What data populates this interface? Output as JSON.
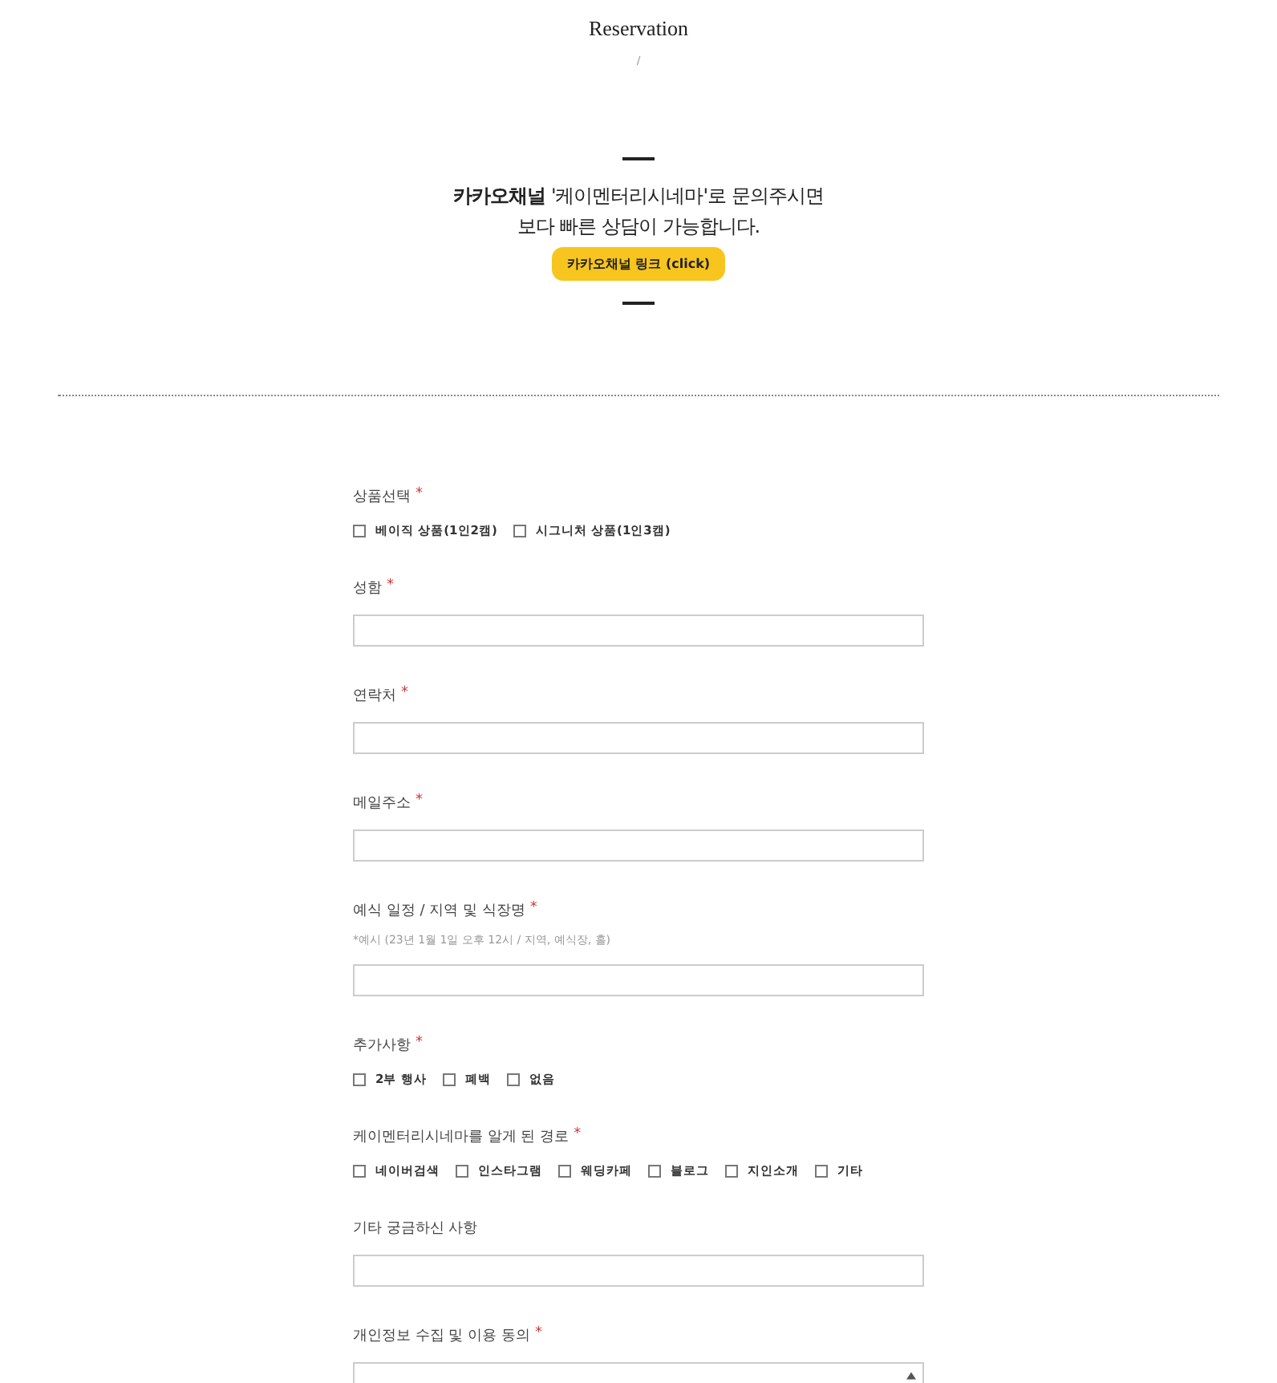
{
  "header": {
    "title": "Reservation",
    "breadcrumb": "/"
  },
  "notice": {
    "lines": [
      "**카카오채널** '케이멘터리시네마'로 문의주시면",
      "보다 빠른 상담이 가능합니다."
    ],
    "button": "카카오채널 링크 (click)"
  },
  "form": {
    "fields": [
      {
        "kind": "checkboxes",
        "label": "상품선택",
        "required_mark": "*",
        "options": [
          {
            "label": "베이직 상품(1인2캠)",
            "checked": false
          },
          {
            "label": "시그니처 상품(1인3캠)",
            "checked": false
          }
        ]
      },
      {
        "kind": "text",
        "label": "성함",
        "required_mark": "*"
      },
      {
        "kind": "text",
        "label": "연락처",
        "required_mark": "*"
      },
      {
        "kind": "text",
        "label": "메일주소",
        "required_mark": "*"
      },
      {
        "kind": "text",
        "label": "예식 일정 / 지역 및 식장명",
        "required_mark": "*",
        "hint": "*예시 (23년 1월 1일 오후 12시 / 지역, 예식장, 홀)"
      },
      {
        "kind": "checkboxes",
        "label": "추가사항",
        "required_mark": "*",
        "options": [
          {
            "label": "2부 행사",
            "checked": false
          },
          {
            "label": "폐백",
            "checked": false
          },
          {
            "label": "없음",
            "checked": false
          }
        ]
      },
      {
        "kind": "checkboxes",
        "label": "케이멘터리시네마를 알게 된 경로",
        "required_mark": "*",
        "options": [
          {
            "label": "네이버검색",
            "checked": false
          },
          {
            "label": "인스타그램",
            "checked": false
          },
          {
            "label": "웨딩카페",
            "checked": false
          },
          {
            "label": "블로그",
            "checked": false
          },
          {
            "label": "지인소개",
            "checked": false
          },
          {
            "label": "기타",
            "checked": false
          }
        ]
      },
      {
        "kind": "text",
        "label": "기타 궁금하신 사항"
      },
      {
        "kind": "textarea",
        "label": "개인정보 수집 및 이용 동의",
        "required_mark": "*"
      }
    ]
  }
}
